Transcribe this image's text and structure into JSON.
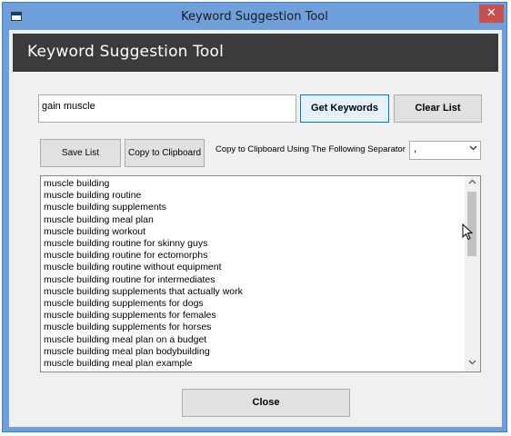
{
  "window": {
    "title": "Keyword Suggestion Tool",
    "close_glyph": "✕"
  },
  "header": {
    "title": "Keyword Suggestion Tool"
  },
  "search": {
    "value": "gain muscle"
  },
  "buttons": {
    "get_keywords": "Get Keywords",
    "clear_list": "Clear List",
    "save_list": "Save List",
    "copy_to_clipboard": "Copy to Clipboard",
    "close": "Close"
  },
  "separator": {
    "label": "Copy to Clipboard Using The Following Separator",
    "selected": ","
  },
  "keywords": [
    "muscle building",
    "muscle building routine",
    "muscle building supplements",
    "muscle building meal plan",
    "muscle building workout",
    "muscle building routine for skinny guys",
    "muscle building routine for ectomorphs",
    "muscle building routine without equipment",
    "muscle building routine for intermediates",
    "muscle building supplements that actually work",
    "muscle building supplements for dogs",
    "muscle building supplements for females",
    "muscle building supplements for horses",
    "muscle building meal plan on a budget",
    "muscle building meal plan bodybuilding",
    "muscle building meal plan example"
  ],
  "colors": {
    "title_bar": "#6fa0dc",
    "header_band": "#3b3b3b",
    "close_button": "#c75050",
    "focused_button": "#e5f1fb"
  }
}
